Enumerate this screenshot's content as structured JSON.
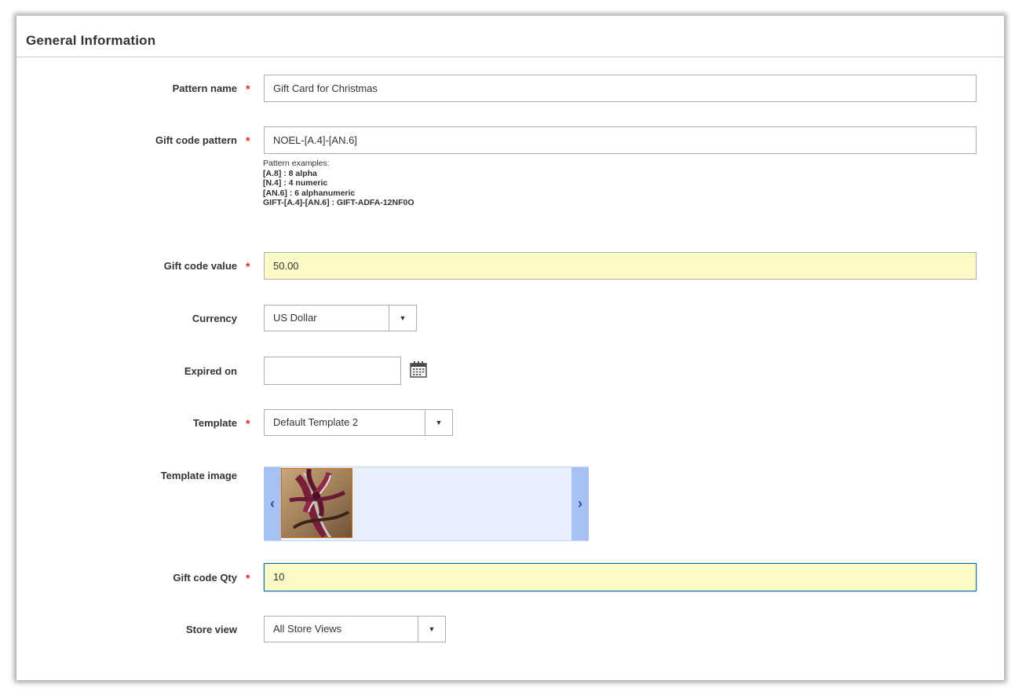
{
  "section": {
    "title": "General Information"
  },
  "fields": {
    "pattern_name": {
      "label": "Pattern name",
      "value": "Gift Card for Christmas",
      "required": true
    },
    "gift_code_pattern": {
      "label": "Gift code pattern",
      "value": "NOEL-[A.4]-[AN.6]",
      "required": true,
      "hint_title": "Pattern examples:",
      "examples": [
        "[A.8] : 8 alpha",
        "[N.4] : 4 numeric",
        "[AN.6] : 6 alphanumeric",
        "GIFT-[A.4]-[AN.6] : GIFT-ADFA-12NF0O"
      ]
    },
    "gift_code_value": {
      "label": "Gift code value",
      "value": "50.00",
      "required": true
    },
    "currency": {
      "label": "Currency",
      "selected": "US Dollar"
    },
    "expired_on": {
      "label": "Expired on",
      "value": ""
    },
    "template": {
      "label": "Template",
      "selected": "Default Template 2",
      "required": true
    },
    "template_image": {
      "label": "Template image"
    },
    "gift_code_qty": {
      "label": "Gift code Qty",
      "value": "10",
      "required": true
    },
    "store_view": {
      "label": "Store view",
      "selected": "All Store Views"
    }
  },
  "required_marker": "*",
  "icons": {
    "select_arrow": "▼",
    "calendar": "calendar-icon",
    "carousel_prev": "‹",
    "carousel_next": "›"
  },
  "colors": {
    "required": "#e22626",
    "highlight_input": "#fbfbc8",
    "focus_border": "#0a6ea8",
    "carousel_bg": "#e8efff",
    "carousel_button": "#a7c2f2"
  }
}
